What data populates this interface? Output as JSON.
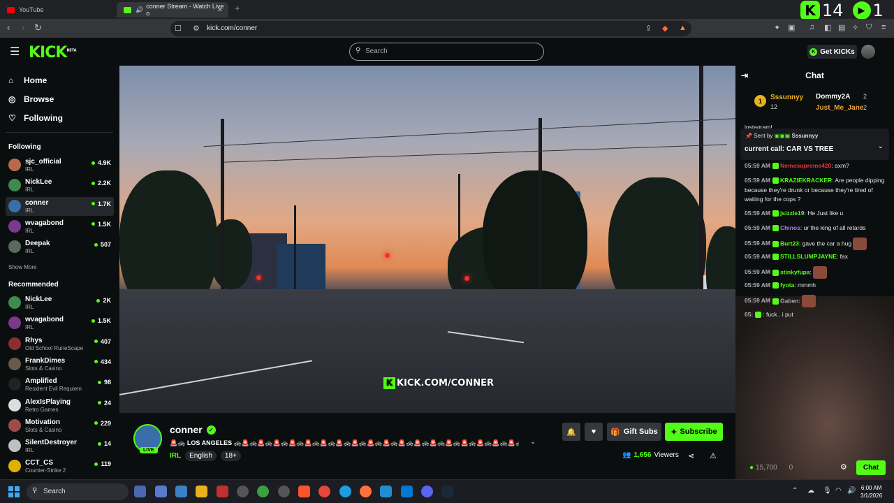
{
  "browser": {
    "tabs": [
      {
        "label": "YouTube",
        "color": "#ff0000"
      },
      {
        "label": "conner Stream - Watch Live o",
        "color": "#53fc18"
      }
    ],
    "url": "kick.com/conner",
    "overlay_counters": [
      "14",
      "1"
    ]
  },
  "header": {
    "logo": "KICK",
    "beta": "BETA",
    "search_placeholder": "Search",
    "get_kicks": "Get KICKs"
  },
  "sidebar": {
    "nav": [
      {
        "label": "Home",
        "icon": "home-icon"
      },
      {
        "label": "Browse",
        "icon": "compass-icon"
      },
      {
        "label": "Following",
        "icon": "heart-icon"
      }
    ],
    "following_title": "Following",
    "following": [
      {
        "name": "sjc_official",
        "category": "IRL",
        "viewers": "4.9K",
        "color": "#b96a4a"
      },
      {
        "name": "NickLee",
        "category": "IRL",
        "viewers": "2.2K",
        "color": "#3f8a4e"
      },
      {
        "name": "conner",
        "category": "IRL",
        "viewers": "1.7K",
        "color": "#3a6ea8"
      },
      {
        "name": "wvagabond",
        "category": "IRL",
        "viewers": "1.5K",
        "color": "#7a3a8c"
      },
      {
        "name": "Deepak",
        "category": "IRL",
        "viewers": "507",
        "color": "#5a6a5a"
      }
    ],
    "show_more": "Show More",
    "recommended_title": "Recommended",
    "recommended": [
      {
        "name": "NickLee",
        "category": "IRL",
        "viewers": "2K",
        "color": "#3f8a4e"
      },
      {
        "name": "wvagabond",
        "category": "IRL",
        "viewers": "1.5K",
        "color": "#7a3a8c"
      },
      {
        "name": "Rhys",
        "category": "Old School RuneScape",
        "viewers": "407",
        "color": "#8c2e2e"
      },
      {
        "name": "FrankDimes",
        "category": "Slots & Casino",
        "viewers": "434",
        "color": "#6a5a4a"
      },
      {
        "name": "Amplified",
        "category": "Resident Evil Requiem",
        "viewers": "98",
        "color": "#222222"
      },
      {
        "name": "AlexIsPlaying",
        "category": "Retro Games",
        "viewers": "24",
        "color": "#dddddd"
      },
      {
        "name": "Motivation",
        "category": "Slots & Casino",
        "viewers": "229",
        "color": "#a04a4a"
      },
      {
        "name": "SilentDestroyer",
        "category": "IRL",
        "viewers": "14",
        "color": "#c0c0c0"
      },
      {
        "name": "CCT_CS",
        "category": "Counter-Strike 2",
        "viewers": "119",
        "color": "#e0b000"
      }
    ]
  },
  "player": {
    "watermark": "KICK.COM/CONNER"
  },
  "stream": {
    "name": "conner",
    "live": "LIVE",
    "title": "🚨🚓 LOS ANGELES 🚓🚨🚓🚨🚓🚨🚓🚨🚓🚨🚓🚨🚓🚨🚓🚨🚓🚨🚓🚨🚓🚨🚓🚨🚓🚨🚓🚨🚓🚨🚓🚨🚓🚨🚓🚨🚓...",
    "category": "IRL",
    "tags": [
      "English",
      "18+"
    ],
    "gift_subs": "Gift Subs",
    "subscribe": "Subscribe",
    "viewers": "1,656",
    "viewers_label": "Viewers"
  },
  "chat": {
    "title": "Chat",
    "leaderboard": [
      {
        "name": "Sssunnyy",
        "count": "12",
        "color": "#e8b21c"
      },
      {
        "name": "Dommy2A",
        "count": "2",
        "color": "#ffffff"
      },
      {
        "name": "Just_Me_Jane",
        "count": "2",
        "color": "#e8a23c"
      }
    ],
    "partial_top": "instagram!",
    "pinned": {
      "sent_by": "Sent by",
      "sender": "Sssunnyy",
      "text": "current call: CAR VS TREE"
    },
    "messages": [
      {
        "time": "05:59 AM",
        "user": "Nemosupreme420",
        "color": "#e2343a",
        "text": ": axm?"
      },
      {
        "time": "05:59 AM",
        "user": "KRAZIEKRACKER",
        "color": "#53fc18",
        "text": ": Are people dipping because they're drunk or because they're tired of waiting for the cops ?"
      },
      {
        "time": "05:59 AM",
        "user": "jsizzle19",
        "color": "#53fc18",
        "text": ": He Just like u"
      },
      {
        "time": "05:59 AM",
        "user": "Chinos",
        "color": "#b57af5",
        "text": ": ur the king of all retards"
      },
      {
        "time": "05:59 AM",
        "user": "Burt23",
        "color": "#53fc18",
        "text": ": gave the car a hug"
      },
      {
        "time": "05:59 AM",
        "user": "STILLSLUMPJAYNE",
        "color": "#53fc18",
        "text": ": fax"
      },
      {
        "time": "05:59 AM",
        "user": "stinkyfupa",
        "color": "#53fc18",
        "text": ":"
      },
      {
        "time": "05:59 AM",
        "user": "fyota",
        "color": "#53fc18",
        "text": ": mmmh"
      },
      {
        "time": "05:59 AM",
        "user": "Gaben",
        "color": "#adadb8",
        "text": ":"
      },
      {
        "time": "05:",
        "user": "",
        "color": "#adadb8",
        "text": ": fuck . i put"
      }
    ],
    "kicks_count": "15,700",
    "kicks_zero": "0",
    "chat_button": "Chat"
  },
  "taskbar": {
    "search": "Search",
    "time": "6:00 AM",
    "date": "3/1/2026"
  }
}
